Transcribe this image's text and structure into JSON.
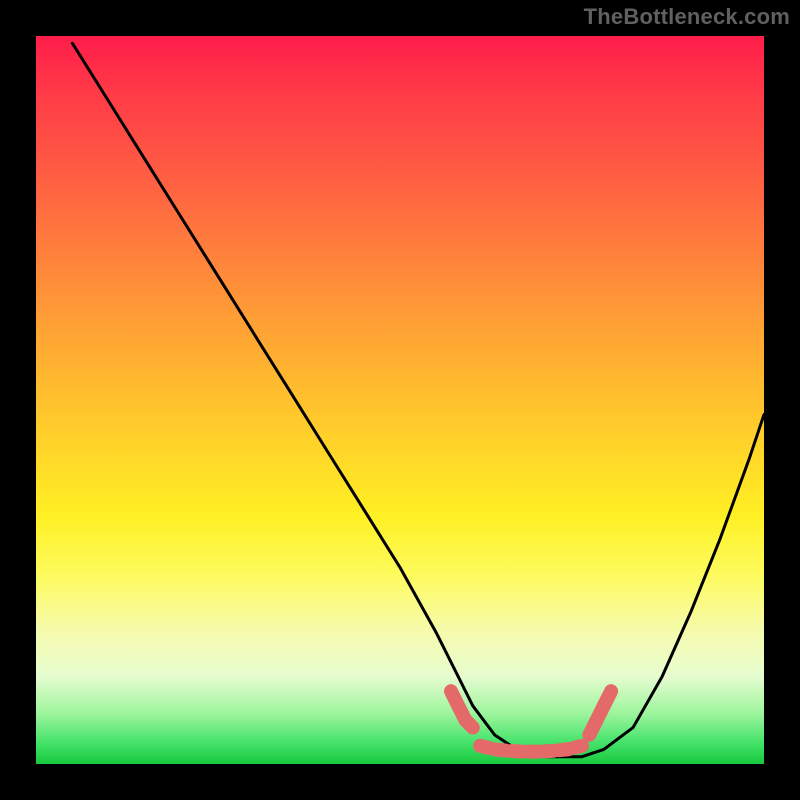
{
  "watermark": "TheBottleneck.com",
  "chart_data": {
    "type": "line",
    "title": "",
    "xlabel": "",
    "ylabel": "",
    "xlim": [
      0,
      100
    ],
    "ylim": [
      0,
      100
    ],
    "grid": false,
    "legend": false,
    "series": [
      {
        "name": "black-curve",
        "color": "#000000",
        "x": [
          5,
          10,
          15,
          20,
          25,
          30,
          35,
          40,
          45,
          50,
          55,
          58,
          60,
          63,
          66,
          70,
          73,
          75,
          78,
          82,
          86,
          90,
          94,
          98,
          100
        ],
        "y": [
          99,
          91,
          83,
          75,
          67,
          59,
          51,
          43,
          35,
          27,
          18,
          12,
          8,
          4,
          2,
          1,
          1,
          1,
          2,
          5,
          12,
          21,
          31,
          42,
          48
        ]
      },
      {
        "name": "red-blob-left",
        "color": "#e46a6a",
        "type": "marker-run",
        "x": [
          57,
          58,
          59,
          60
        ],
        "y": [
          10,
          8,
          6,
          5
        ]
      },
      {
        "name": "red-blob-flat",
        "color": "#e46a6a",
        "type": "marker-run",
        "x": [
          61,
          63,
          65,
          67,
          69,
          71,
          73,
          75
        ],
        "y": [
          2.5,
          2,
          1.8,
          1.7,
          1.7,
          1.8,
          2,
          2.5
        ]
      },
      {
        "name": "red-blob-right",
        "color": "#e46a6a",
        "type": "marker-run",
        "x": [
          76,
          77,
          78,
          79
        ],
        "y": [
          4,
          6,
          8,
          10
        ]
      }
    ],
    "gradient_stops": [
      {
        "pos": 0,
        "color": "#ff1d4a"
      },
      {
        "pos": 8,
        "color": "#ff3b47"
      },
      {
        "pos": 18,
        "color": "#ff5a43"
      },
      {
        "pos": 28,
        "color": "#ff7a3d"
      },
      {
        "pos": 38,
        "color": "#ff9b36"
      },
      {
        "pos": 48,
        "color": "#ffbb2f"
      },
      {
        "pos": 58,
        "color": "#ffd928"
      },
      {
        "pos": 66,
        "color": "#fff024"
      },
      {
        "pos": 74,
        "color": "#fdfb5e"
      },
      {
        "pos": 82,
        "color": "#f6fbaf"
      },
      {
        "pos": 88,
        "color": "#e6fcd0"
      },
      {
        "pos": 93,
        "color": "#9ef59d"
      },
      {
        "pos": 97,
        "color": "#46e36b"
      },
      {
        "pos": 100,
        "color": "#17c93d"
      }
    ]
  }
}
